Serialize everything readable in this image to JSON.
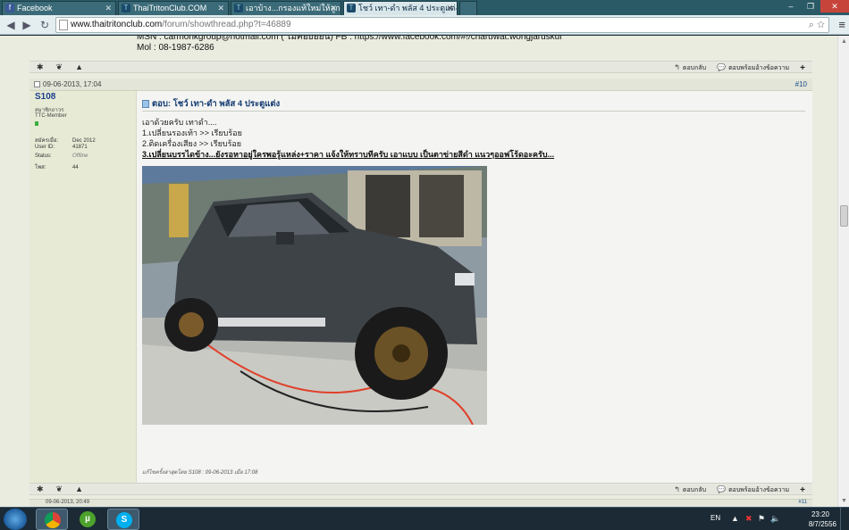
{
  "browser": {
    "tabs": [
      {
        "label": "Facebook",
        "icon": "f",
        "active": false
      },
      {
        "label": "ThaiTritonClub.COM",
        "icon": "T",
        "active": false
      },
      {
        "label": "เอาบ้าง...กรองแท้ใหม่ให้ลูก",
        "icon": "T",
        "active": false
      },
      {
        "label": "โชว์ เทา-ดำ พลัส 4 ประตูแต่ง",
        "icon": "T",
        "active": true
      }
    ],
    "window_controls": {
      "minimize": "–",
      "maximize": "❐",
      "close": "✕"
    },
    "url_host": "www.thaitritonclub.com",
    "url_path": "/forum/showthread.php?t=46889"
  },
  "forum": {
    "prev_signature": [
      "MSN : carmonkgroup@hotmail.com ( ไม่ค่อยออน) FB : https://www.facebook.com/#!/charuwat.wongjaruskul",
      "Mol : 08-1987-6286"
    ],
    "post": {
      "date": "09-06-2013, 17:04",
      "number": "#10",
      "username": "S108",
      "user_title": "สมาชิกถาวร",
      "user_group": "TTC-Member",
      "user_details": [
        {
          "label": "สมัครเมื่อ:",
          "value": "Dec 2012"
        },
        {
          "label": "User ID:",
          "value": "41871"
        },
        {
          "label": "Status:",
          "value": "Offline"
        },
        {
          "label": "โพส:",
          "value": "44"
        }
      ],
      "title": "ตอบ: โชว์ เทา-ดำ พลัส 4 ประตูแต่ง",
      "body_lines": [
        "เอาด้วยครับ เทาดำ....",
        "1.เปลี่ยนรองเท้า >> เรียบร้อย",
        "2.ติดเครื่องเสียง >> เรียบร้อย"
      ],
      "body_emphasis": "3.เปลี่ยนบรรไดข้าง...ยังรอหาอยู่ใครพอรู้แหล่ง+ราคา แจ้งให้ทราบทีครับ เอาแบบ เป็นตาข่ายสีดำ แนวๆออฟโร้ดอะครับ...",
      "edit_note": "แก้ไขครั้งล่าสุดโดย S108 : 09-06-2013 เมื่อ 17:08"
    },
    "actions": {
      "reply_label": "ตอบกลับ",
      "quote_label": "ตอบพร้อมอ้างข้อความ",
      "reply_icon": "↰",
      "quote_icon": "💬",
      "multiquote_icon": "+"
    },
    "next_post_date": "09-06-2013, 20:49",
    "next_post_number": "#11"
  },
  "taskbar": {
    "apps": [
      "Chrome",
      "uTorrent",
      "Skype"
    ],
    "language": "EN",
    "time": "23:20",
    "date": "8/7/2556"
  }
}
